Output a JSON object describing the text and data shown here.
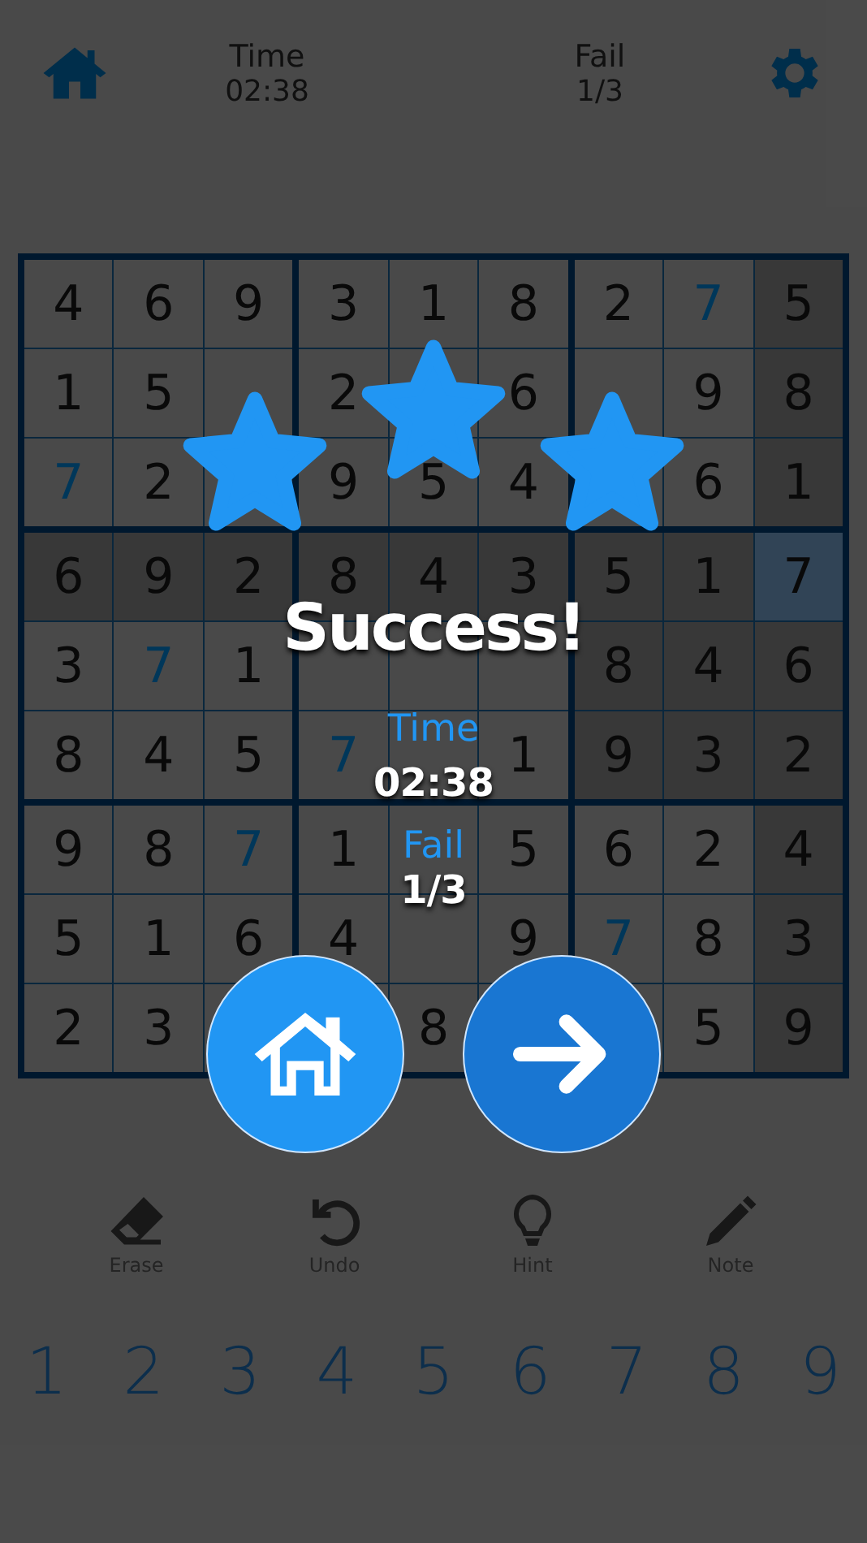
{
  "header": {
    "time_label": "Time",
    "time": "02:38",
    "fail_label": "Fail",
    "fail": "1/3"
  },
  "board": {
    "rows": [
      [
        {
          "v": "4",
          "kind": "given",
          "highlighted": false,
          "selected": false
        },
        {
          "v": "6",
          "kind": "given",
          "highlighted": false,
          "selected": false
        },
        {
          "v": "9",
          "kind": "given",
          "highlighted": false,
          "selected": false
        },
        {
          "v": "3",
          "kind": "given",
          "highlighted": false,
          "selected": false
        },
        {
          "v": "1",
          "kind": "given",
          "highlighted": false,
          "selected": false
        },
        {
          "v": "8",
          "kind": "given",
          "highlighted": false,
          "selected": false
        },
        {
          "v": "2",
          "kind": "given",
          "highlighted": false,
          "selected": false
        },
        {
          "v": "7",
          "kind": "entered",
          "highlighted": false,
          "selected": false
        },
        {
          "v": "5",
          "kind": "given",
          "highlighted": true,
          "selected": false
        }
      ],
      [
        {
          "v": "1",
          "kind": "given",
          "highlighted": false,
          "selected": false
        },
        {
          "v": "5",
          "kind": "given",
          "highlighted": false,
          "selected": false
        },
        {
          "kind": "given",
          "highlighted": false,
          "selected": false
        },
        {
          "v": "2",
          "kind": "given",
          "highlighted": false,
          "selected": false
        },
        {
          "kind": "given",
          "highlighted": false,
          "selected": false
        },
        {
          "v": "6",
          "kind": "given",
          "highlighted": false,
          "selected": false
        },
        {
          "kind": "given",
          "highlighted": false,
          "selected": false
        },
        {
          "v": "9",
          "kind": "given",
          "highlighted": false,
          "selected": false
        },
        {
          "v": "8",
          "kind": "given",
          "highlighted": true,
          "selected": false
        }
      ],
      [
        {
          "v": "7",
          "kind": "entered",
          "highlighted": false,
          "selected": false
        },
        {
          "v": "2",
          "kind": "given",
          "highlighted": false,
          "selected": false
        },
        {
          "kind": "given",
          "highlighted": false,
          "selected": false
        },
        {
          "v": "9",
          "kind": "given",
          "highlighted": false,
          "selected": false
        },
        {
          "v": "5",
          "kind": "given",
          "highlighted": false,
          "selected": false
        },
        {
          "v": "4",
          "kind": "given",
          "highlighted": false,
          "selected": false
        },
        {
          "kind": "given",
          "highlighted": false,
          "selected": false
        },
        {
          "v": "6",
          "kind": "given",
          "highlighted": false,
          "selected": false
        },
        {
          "v": "1",
          "kind": "given",
          "highlighted": true,
          "selected": false
        }
      ],
      [
        {
          "v": "6",
          "kind": "given",
          "highlighted": true,
          "selected": false
        },
        {
          "v": "9",
          "kind": "given",
          "highlighted": true,
          "selected": false
        },
        {
          "v": "2",
          "kind": "given",
          "highlighted": true,
          "selected": false
        },
        {
          "v": "8",
          "kind": "given",
          "highlighted": true,
          "selected": false
        },
        {
          "v": "4",
          "kind": "given",
          "highlighted": true,
          "selected": false
        },
        {
          "v": "3",
          "kind": "given",
          "highlighted": true,
          "selected": false
        },
        {
          "v": "5",
          "kind": "given",
          "highlighted": true,
          "selected": false
        },
        {
          "v": "1",
          "kind": "given",
          "highlighted": true,
          "selected": false
        },
        {
          "v": "7",
          "kind": "given",
          "highlighted": true,
          "selected": true
        }
      ],
      [
        {
          "v": "3",
          "kind": "given",
          "highlighted": false,
          "selected": false
        },
        {
          "v": "7",
          "kind": "entered",
          "highlighted": false,
          "selected": false
        },
        {
          "v": "1",
          "kind": "given",
          "highlighted": false,
          "selected": false
        },
        {
          "kind": "entered",
          "highlighted": false,
          "selected": false
        },
        {
          "kind": "given",
          "highlighted": false,
          "selected": false
        },
        {
          "kind": "given",
          "highlighted": false,
          "selected": false
        },
        {
          "v": "8",
          "kind": "given",
          "highlighted": true,
          "selected": false
        },
        {
          "v": "4",
          "kind": "given",
          "highlighted": true,
          "selected": false
        },
        {
          "v": "6",
          "kind": "given",
          "highlighted": true,
          "selected": false
        }
      ],
      [
        {
          "v": "8",
          "kind": "given",
          "highlighted": false,
          "selected": false
        },
        {
          "v": "4",
          "kind": "given",
          "highlighted": false,
          "selected": false
        },
        {
          "v": "5",
          "kind": "given",
          "highlighted": false,
          "selected": false
        },
        {
          "v": "7",
          "kind": "entered",
          "highlighted": false,
          "selected": false
        },
        {
          "kind": "given",
          "highlighted": false,
          "selected": false
        },
        {
          "v": "1",
          "kind": "given",
          "highlighted": false,
          "selected": false
        },
        {
          "v": "9",
          "kind": "given",
          "highlighted": true,
          "selected": false
        },
        {
          "v": "3",
          "kind": "given",
          "highlighted": true,
          "selected": false
        },
        {
          "v": "2",
          "kind": "given",
          "highlighted": true,
          "selected": false
        }
      ],
      [
        {
          "v": "9",
          "kind": "given",
          "highlighted": false,
          "selected": false
        },
        {
          "v": "8",
          "kind": "given",
          "highlighted": false,
          "selected": false
        },
        {
          "v": "7",
          "kind": "entered",
          "highlighted": false,
          "selected": false
        },
        {
          "v": "1",
          "kind": "given",
          "highlighted": false,
          "selected": false
        },
        {
          "kind": "given",
          "highlighted": false,
          "selected": false
        },
        {
          "v": "5",
          "kind": "given",
          "highlighted": false,
          "selected": false
        },
        {
          "v": "6",
          "kind": "given",
          "highlighted": false,
          "selected": false
        },
        {
          "v": "2",
          "kind": "given",
          "highlighted": false,
          "selected": false
        },
        {
          "v": "4",
          "kind": "given",
          "highlighted": true,
          "selected": false
        }
      ],
      [
        {
          "v": "5",
          "kind": "given",
          "highlighted": false,
          "selected": false
        },
        {
          "v": "1",
          "kind": "given",
          "highlighted": false,
          "selected": false
        },
        {
          "v": "6",
          "kind": "given",
          "highlighted": false,
          "selected": false
        },
        {
          "v": "4",
          "kind": "given",
          "highlighted": false,
          "selected": false
        },
        {
          "kind": "given",
          "highlighted": false,
          "selected": false
        },
        {
          "v": "9",
          "kind": "given",
          "highlighted": false,
          "selected": false
        },
        {
          "v": "7",
          "kind": "entered",
          "highlighted": false,
          "selected": false
        },
        {
          "v": "8",
          "kind": "given",
          "highlighted": false,
          "selected": false
        },
        {
          "v": "3",
          "kind": "given",
          "highlighted": true,
          "selected": false
        }
      ],
      [
        {
          "v": "2",
          "kind": "given",
          "highlighted": false,
          "selected": false
        },
        {
          "v": "3",
          "kind": "given",
          "highlighted": false,
          "selected": false
        },
        {
          "kind": "given",
          "highlighted": false,
          "selected": false
        },
        {
          "kind": "given",
          "highlighted": false,
          "selected": false
        },
        {
          "v": "8",
          "kind": "given",
          "highlighted": false,
          "selected": false
        },
        {
          "kind": "entered",
          "highlighted": false,
          "selected": false
        },
        {
          "kind": "given",
          "highlighted": false,
          "selected": false
        },
        {
          "v": "5",
          "kind": "given",
          "highlighted": false,
          "selected": false
        },
        {
          "v": "9",
          "kind": "given",
          "highlighted": true,
          "selected": false
        }
      ]
    ]
  },
  "tools": [
    {
      "label": "Erase",
      "kind": "erase"
    },
    {
      "label": "Undo",
      "kind": "undo"
    },
    {
      "label": "Hint",
      "kind": "hint"
    },
    {
      "label": "Note",
      "kind": "note"
    }
  ],
  "numbers": [
    "1",
    "2",
    "3",
    "4",
    "5",
    "6",
    "7",
    "8",
    "9"
  ],
  "result": {
    "stars": 3,
    "title": "Success!",
    "time_label": "Time",
    "time": "02:38",
    "fail_label": "Fail",
    "fail": "1/3",
    "buttons": [
      {
        "kind": "home"
      },
      {
        "kind": "next"
      }
    ]
  }
}
